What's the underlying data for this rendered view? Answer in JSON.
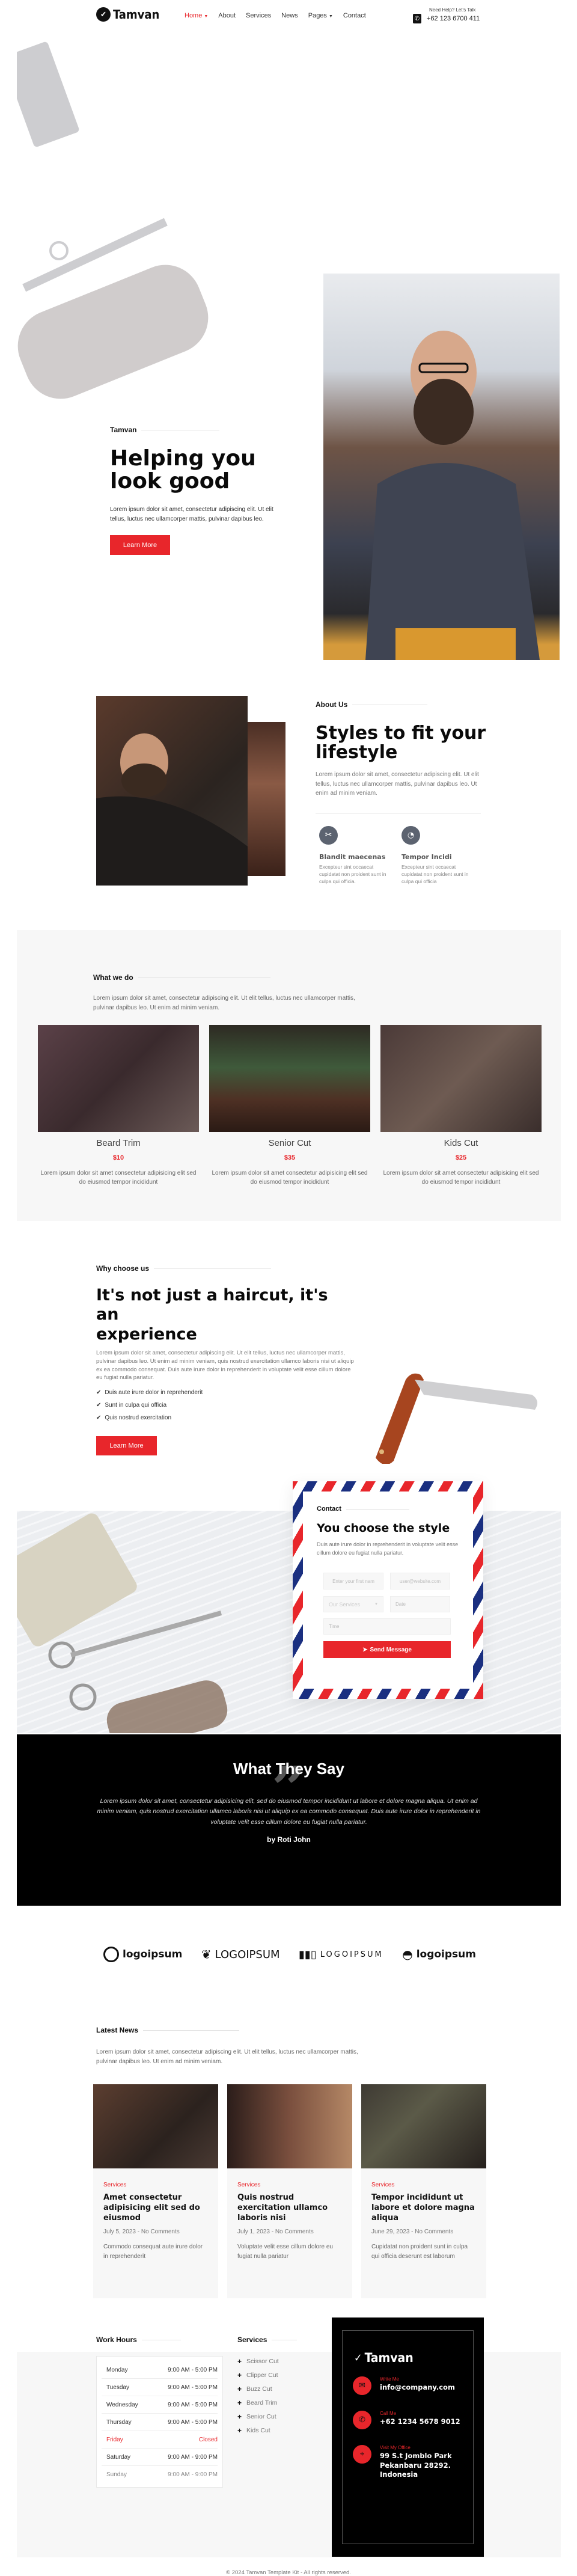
{
  "header": {
    "brand": "Tamvan",
    "nav": [
      {
        "label": "Home",
        "active": true,
        "has_dropdown": true
      },
      {
        "label": "About",
        "active": false,
        "has_dropdown": false
      },
      {
        "label": "Services",
        "active": false,
        "has_dropdown": false
      },
      {
        "label": "News",
        "active": false,
        "has_dropdown": false
      },
      {
        "label": "Pages",
        "active": false,
        "has_dropdown": true
      },
      {
        "label": "Contact",
        "active": false,
        "has_dropdown": false
      }
    ],
    "help_label": "Need Help? Let's Talk",
    "phone": "+62 123 6700 411"
  },
  "hero": {
    "kicker": "Tamvan",
    "title_line1": "Helping you",
    "title_line2": "look good",
    "text": "Lorem ipsum dolor sit amet, consectetur adipiscing elit. Ut elit tellus, luctus nec ullamcorper mattis, pulvinar dapibus leo.",
    "button": "Learn More"
  },
  "about": {
    "kicker": "About Us",
    "title_line1": "Styles to fit your",
    "title_line2": "lifestyle",
    "text": "Lorem ipsum dolor sit amet, consectetur adipiscing elit. Ut elit tellus, luctus nec ullamcorper mattis, pulvinar dapibus leo. Ut enim ad minim veniam.",
    "features": [
      {
        "icon": "scissors-icon",
        "title": "Blandit maecenas",
        "text": "Excepteur sint occaecat cupidatat non proident sunt in culpa qui officia."
      },
      {
        "icon": "razor-icon",
        "title": "Tempor Incidi",
        "text": "Excepteur sint occaecat cupidatat non proident sunt in culpa qui officia"
      }
    ]
  },
  "what_we_do": {
    "kicker": "What we do",
    "text": "Lorem ipsum dolor sit amet, consectetur adipiscing elit. Ut elit tellus, luctus nec ullamcorper mattis, pulvinar dapibus leo. Ut enim ad minim veniam.",
    "services": [
      {
        "title": "Beard Trim",
        "price": "$10",
        "text": "Lorem ipsum dolor sit amet consectetur adipisicing elit sed do eiusmod tempor incididunt"
      },
      {
        "title": "Senior Cut",
        "price": "$35",
        "text": "Lorem ipsum dolor sit amet consectetur adipisicing elit sed do eiusmod tempor incididunt"
      },
      {
        "title": "Kids Cut",
        "price": "$25",
        "text": "Lorem ipsum dolor sit amet consectetur adipisicing elit sed do eiusmod tempor incididunt"
      }
    ]
  },
  "why": {
    "kicker": "Why choose us",
    "title_line1": "It's not just a haircut, it's an",
    "title_line2": "experience",
    "text": "Lorem ipsum dolor sit amet, consectetur adipiscing elit. Ut elit tellus, luctus nec ullamcorper mattis, pulvinar dapibus leo. Ut enim ad minim veniam, quis nostrud exercitation ullamco laboris nisi ut aliquip ex ea commodo consequat. Duis aute irure dolor in reprehenderit in voluptate velit esse cillum dolore eu fugiat nulla pariatur.",
    "checklist": [
      "Duis aute irure dolor in reprehenderit",
      "Sunt in culpa qui officia",
      "Quis nostrud exercitation"
    ],
    "button": "Learn More"
  },
  "contact": {
    "kicker": "Contact",
    "title": "You choose the style",
    "text": "Duis aute irure dolor in reprehenderit in voluptate velit esse cillum dolore eu fugiat nulla pariatur.",
    "first_name_placeholder": "Enter your first nam",
    "email_placeholder": "user@website.com",
    "service_select": "Our Services",
    "date_placeholder": "Date",
    "time_placeholder": "Time",
    "submit": "Send Message",
    "stripe_red": "#e8262b",
    "stripe_blue": "#1a2f80"
  },
  "testimonial": {
    "title": "What They Say",
    "quote": "Lorem ipsum dolor sit amet, consectetur adipisicing elit, sed do eiusmod tempor incididunt ut labore et dolore magna aliqua. Ut enim ad minim veniam, quis nostrud exercitation ullamco laboris nisi ut aliquip ex ea commodo consequat. Duis aute irure dolor in reprehenderit in voluptate velit esse cillum dolore eu fugiat nulla pariatur.",
    "author": "by Roti John"
  },
  "partners": [
    "logoipsum",
    "LOGOIPSUM",
    "LOGOIPSUM",
    "logoipsum"
  ],
  "news": {
    "kicker": "Latest News",
    "text": "Lorem ipsum dolor sit amet, consectetur adipiscing elit. Ut elit tellus, luctus nec ullamcorper mattis, pulvinar dapibus leo. Ut enim ad minim veniam.",
    "posts": [
      {
        "category": "Services",
        "title": "Amet consectetur adipisicing elit sed do eiusmod",
        "date": "July 5, 2023",
        "comments": "No Comments",
        "excerpt": "Commodo consequat aute irure dolor in reprehenderit"
      },
      {
        "category": "Services",
        "title": "Quis nostrud exercitation ullamco laboris nisi",
        "date": "July 1, 2023",
        "comments": "No Comments",
        "excerpt": "Voluptate velit esse cillum dolore eu fugiat nulla pariatur"
      },
      {
        "category": "Services",
        "title": "Tempor incididunt ut labore et dolore magna aliqua",
        "date": "June 29, 2023",
        "comments": "No Comments",
        "excerpt": "Cupidatat non proident sunt in culpa qui officia deserunt est laborum"
      }
    ]
  },
  "footer": {
    "hours_title": "Work Hours",
    "hours": [
      {
        "day": "Monday",
        "time": "9:00 AM - 5:00 PM",
        "status": "open"
      },
      {
        "day": "Tuesday",
        "time": "9:00 AM - 5:00 PM",
        "status": "open"
      },
      {
        "day": "Wednesday",
        "time": "9:00 AM - 5:00 PM",
        "status": "open"
      },
      {
        "day": "Thursday",
        "time": "9:00 AM - 5:00 PM",
        "status": "open"
      },
      {
        "day": "Friday",
        "time": "Closed",
        "status": "closed"
      },
      {
        "day": "Saturday",
        "time": "9:00 AM - 9:00 PM",
        "status": "open"
      },
      {
        "day": "Sunday",
        "time": "9:00 AM - 9:00 PM",
        "status": "muted"
      }
    ],
    "services_title": "Services",
    "services": [
      "Scissor Cut",
      "Clipper Cut",
      "Buzz Cut",
      "Beard Trim",
      "Senior Cut",
      "Kids Cut"
    ],
    "brand": "Tamvan",
    "contacts": [
      {
        "icon": "envelope-icon",
        "label": "Write Me",
        "value": "info@company.com"
      },
      {
        "icon": "phone-icon",
        "label": "Call Me",
        "value": "+62 1234 5678 9012"
      },
      {
        "icon": "map-icon",
        "label": "Visit My Office",
        "value": "99 S.t Jomblo Park Pekanbaru 28292. Indonesia"
      }
    ],
    "copyright": "© 2024 Tamvan Template Kit - All rights reserved."
  },
  "colors": {
    "accent": "#e8262b",
    "dark": "#000000",
    "light_bg": "#f7f7f7"
  }
}
